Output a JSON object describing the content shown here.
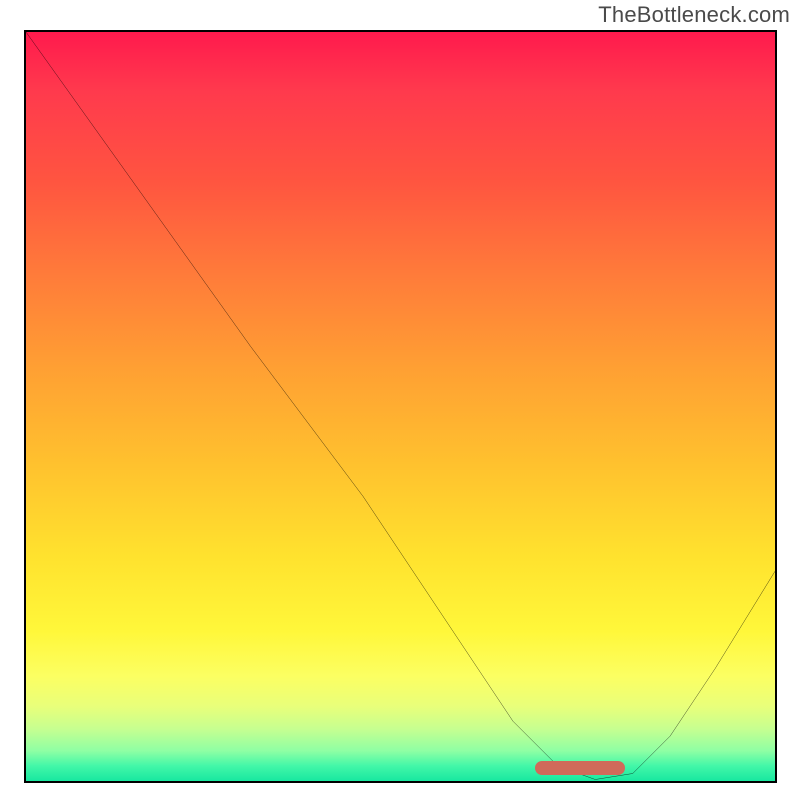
{
  "attribution": "TheBottleneck.com",
  "chart_data": {
    "type": "line",
    "title": "",
    "xlabel": "",
    "ylabel": "",
    "xlim": [
      0,
      100
    ],
    "ylim": [
      0,
      100
    ],
    "curve_points": [
      {
        "x": 0.0,
        "y": 100.0
      },
      {
        "x": 20.0,
        "y": 72.0
      },
      {
        "x": 30.0,
        "y": 58.0
      },
      {
        "x": 45.0,
        "y": 38.0
      },
      {
        "x": 57.0,
        "y": 20.0
      },
      {
        "x": 65.0,
        "y": 8.0
      },
      {
        "x": 71.0,
        "y": 2.0
      },
      {
        "x": 76.0,
        "y": 0.2
      },
      {
        "x": 81.0,
        "y": 1.0
      },
      {
        "x": 86.0,
        "y": 6.0
      },
      {
        "x": 92.0,
        "y": 15.0
      },
      {
        "x": 100.0,
        "y": 28.0
      }
    ],
    "highlight_range": {
      "x_start": 68,
      "x_end": 80,
      "y": 1.8
    },
    "background_gradient": {
      "top": "#ff1a4d",
      "mid": "#ffe22e",
      "bottom": "#18e8a0"
    },
    "annotations": []
  }
}
